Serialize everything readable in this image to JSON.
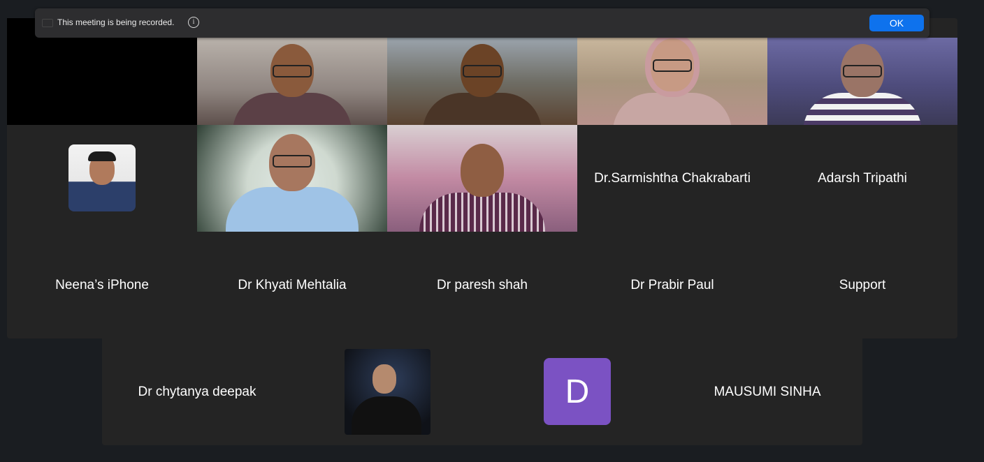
{
  "banner": {
    "message": "This meeting is being recorded.",
    "info_icon": "info-icon",
    "ok_label": "OK"
  },
  "participants": {
    "row1": [
      {
        "name": "",
        "state": "video-off"
      },
      {
        "name": "",
        "state": "video"
      },
      {
        "name": "",
        "state": "video",
        "active_speaker": true
      },
      {
        "name": "",
        "state": "video"
      },
      {
        "name": "",
        "state": "video"
      }
    ],
    "row2": [
      {
        "name": "",
        "state": "profile-photo"
      },
      {
        "name": "",
        "state": "video"
      },
      {
        "name": "",
        "state": "video"
      },
      {
        "name": "Dr.Sarmishtha Chakrabarti",
        "state": "name-only"
      },
      {
        "name": "Adarsh Tripathi",
        "state": "name-only"
      }
    ],
    "row3": [
      {
        "name": "Neena’s iPhone",
        "state": "name-only"
      },
      {
        "name": "Dr Khyati Mehtalia",
        "state": "name-only"
      },
      {
        "name": "Dr paresh shah",
        "state": "name-only"
      },
      {
        "name": "Dr Prabir Paul",
        "state": "name-only"
      },
      {
        "name": "Support",
        "state": "name-only"
      }
    ],
    "row4": [
      {
        "name": "Dr chytanya deepak",
        "state": "name-only"
      },
      {
        "name": "",
        "state": "profile-photo"
      },
      {
        "name": "",
        "state": "letter-avatar",
        "letter": "D"
      },
      {
        "name": "MAUSUMI SINHA",
        "state": "name-only"
      }
    ]
  },
  "colors": {
    "background": "#1a1d21",
    "tile": "#242424",
    "accent_button": "#0e72ed",
    "active_speaker": "#22c55e",
    "letter_avatar": "#7b52c3"
  }
}
